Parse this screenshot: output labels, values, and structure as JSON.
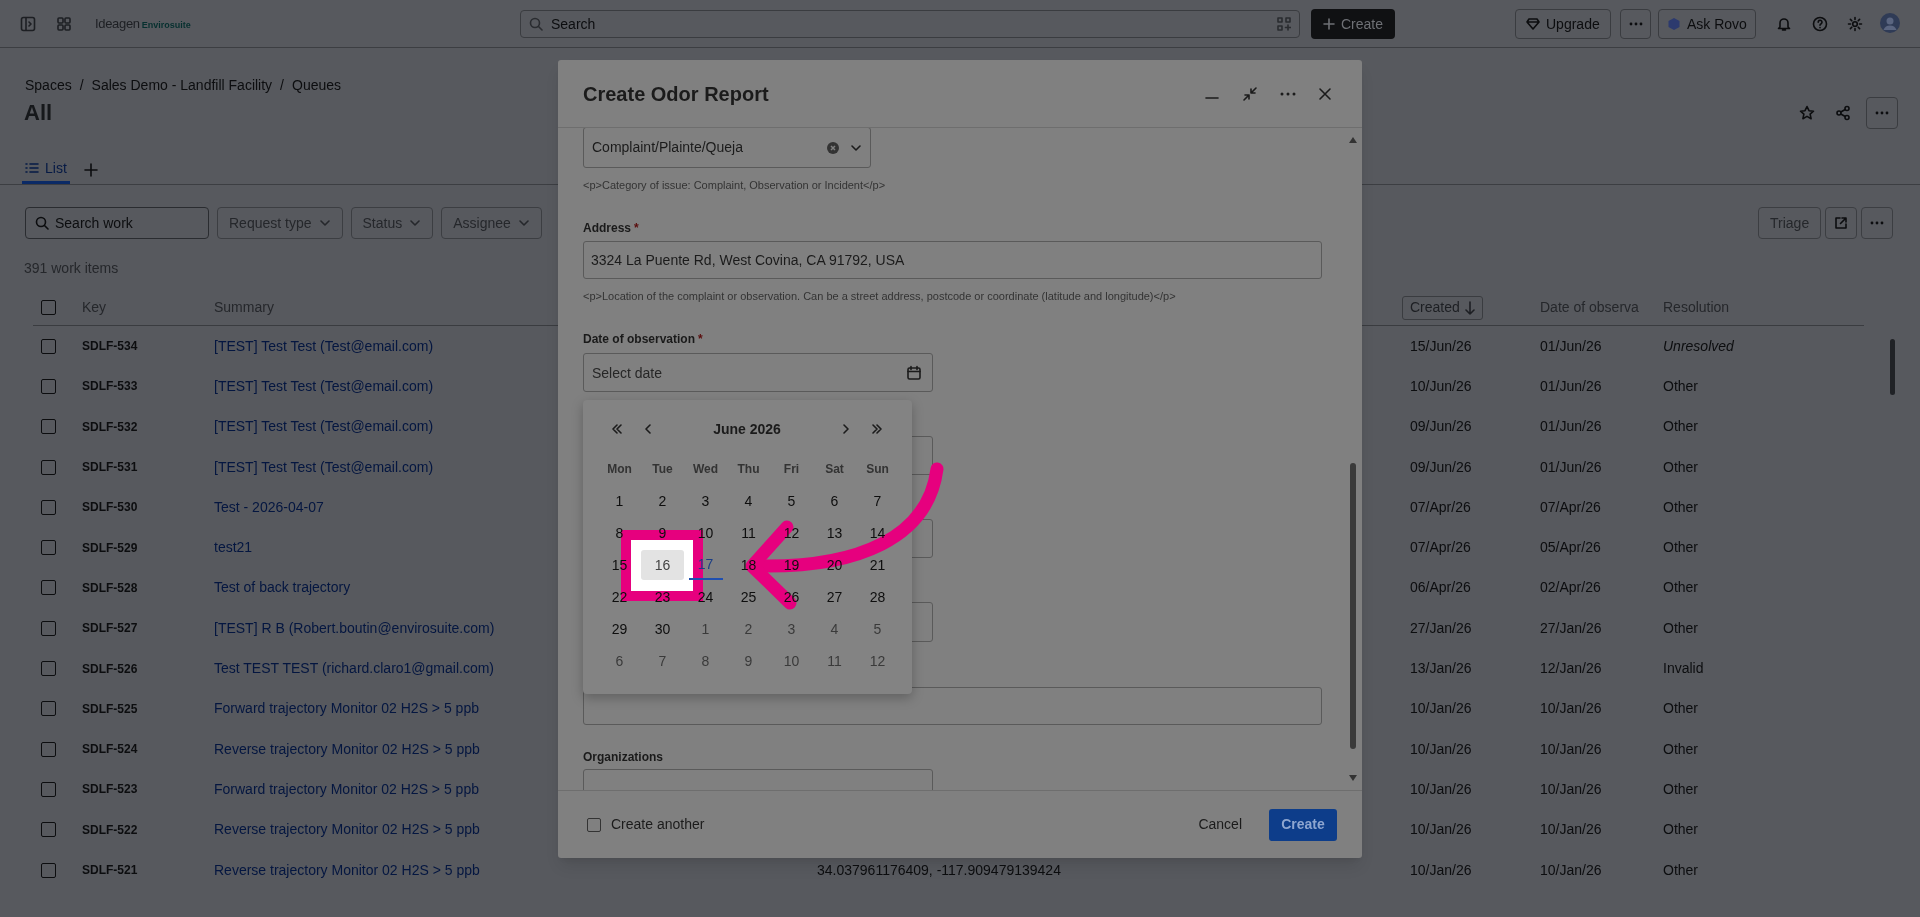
{
  "top_bar": {
    "logo": {
      "name": "Ideagen",
      "product": "Envirosuite"
    },
    "search": {
      "placeholder": "Search"
    },
    "create_button": "Create",
    "upgrade_button": "Upgrade",
    "ask_button": "Ask Rovo"
  },
  "breadcrumbs": {
    "separator": "/",
    "items": [
      "Spaces",
      "Sales Demo - Landfill Facility",
      "Queues"
    ]
  },
  "title": "All",
  "view_tabs": [
    {
      "label": "List",
      "selected": true
    }
  ],
  "filters": {
    "search": {
      "placeholder": "Search work"
    },
    "dropdowns": [
      "Request type",
      "Status",
      "Assignee"
    ],
    "triage_button": "Triage"
  },
  "count": "391 work items",
  "table": {
    "select_all_checked": false,
    "columns": [
      "Key",
      "Summary",
      "Created",
      "Date of observa",
      "Resolution"
    ],
    "rows": [
      {
        "key": "SDLF-534",
        "checked": false,
        "summary": "[TEST] Test Test (Test@email.com)",
        "created": "15/Jun/26",
        "date_of_observation": "01/Jun/26",
        "resolution": "Unresolved",
        "resolved": false
      },
      {
        "key": "SDLF-533",
        "checked": false,
        "summary": "[TEST] Test Test (Test@email.com)",
        "created": "10/Jun/26",
        "date_of_observation": "01/Jun/26",
        "resolution": "Other",
        "resolved": true
      },
      {
        "key": "SDLF-532",
        "checked": false,
        "summary": "[TEST] Test Test (Test@email.com)",
        "created": "09/Jun/26",
        "date_of_observation": "01/Jun/26",
        "resolution": "Other",
        "resolved": true
      },
      {
        "key": "SDLF-531",
        "checked": false,
        "summary": "[TEST] Test Test (Test@email.com)",
        "created": "09/Jun/26",
        "date_of_observation": "01/Jun/26",
        "resolution": "Other",
        "resolved": true
      },
      {
        "key": "SDLF-530",
        "checked": false,
        "summary": "Test - 2026-04-07",
        "created": "07/Apr/26",
        "date_of_observation": "07/Apr/26",
        "resolution": "Other",
        "resolved": true
      },
      {
        "key": "SDLF-529",
        "checked": false,
        "summary": "test21",
        "created": "07/Apr/26",
        "date_of_observation": "05/Apr/26",
        "resolution": "Other",
        "resolved": true
      },
      {
        "key": "SDLF-528",
        "checked": false,
        "summary": "Test of back trajectory",
        "created": "06/Apr/26",
        "date_of_observation": "02/Apr/26",
        "resolution": "Other",
        "resolved": true
      },
      {
        "key": "SDLF-527",
        "checked": false,
        "summary": "[TEST] R B (Robert.boutin@envirosuite.com)",
        "created": "27/Jan/26",
        "date_of_observation": "27/Jan/26",
        "resolution": "Other",
        "resolved": true
      },
      {
        "key": "SDLF-526",
        "checked": false,
        "summary": "Test TEST TEST (richard.claro1@gmail.com)",
        "created": "13/Jan/26",
        "date_of_observation": "12/Jan/26",
        "resolution": "Invalid",
        "resolved": true
      },
      {
        "key": "SDLF-525",
        "checked": false,
        "summary": "Forward trajectory Monitor 02 H2S > 5 ppb",
        "created": "10/Jan/26",
        "date_of_observation": "10/Jan/26",
        "resolution": "Other",
        "resolved": true
      },
      {
        "key": "SDLF-524",
        "checked": false,
        "summary": "Reverse trajectory Monitor 02 H2S > 5 ppb",
        "created": "10/Jan/26",
        "date_of_observation": "10/Jan/26",
        "resolution": "Other",
        "resolved": true
      },
      {
        "key": "SDLF-523",
        "checked": false,
        "summary": "Forward trajectory Monitor 02 H2S > 5 ppb",
        "created": "10/Jan/26",
        "date_of_observation": "10/Jan/26",
        "resolution": "Other",
        "resolved": true
      },
      {
        "key": "SDLF-522",
        "checked": false,
        "summary": "Reverse trajectory Monitor 02 H2S > 5 ppb",
        "created": "10/Jan/26",
        "date_of_observation": "10/Jan/26",
        "resolution": "Other",
        "resolved": true
      },
      {
        "key": "SDLF-521",
        "checked": false,
        "summary": "Reverse trajectory Monitor 02 H2S > 5 ppb",
        "column_3": "34.037961176409, -117.909479139424",
        "created": "10/Jan/26",
        "date_of_observation": "10/Jan/26",
        "resolution": "Other",
        "resolved": true
      }
    ]
  },
  "dialog": {
    "title": "Create Odor Report",
    "category": {
      "value": "Complaint/Plainte/Queja",
      "help": "<p>Category of issue: Complaint, Observation or Incident</p>"
    },
    "address": {
      "label": "Address",
      "required_mark": "*",
      "value": "3324 La Puente Rd, West Covina, CA 91792, USA",
      "help": "<p>Location of the complaint or observation. Can be a street address, postcode or coordinate (latitude and longitude)</p>"
    },
    "date": {
      "label": "Date of observation",
      "required_mark": "*",
      "placeholder": "Select date"
    },
    "organizations": {
      "label": "Organizations"
    },
    "calendar": {
      "month": "June 2026",
      "weekdays": [
        "Mon",
        "Tue",
        "Wed",
        "Thu",
        "Fri",
        "Sat",
        "Sun"
      ],
      "days": [
        {
          "label": "1",
          "outside": false,
          "today": false,
          "focused": false
        },
        {
          "label": "2",
          "outside": false,
          "today": false,
          "focused": false
        },
        {
          "label": "3",
          "outside": false,
          "today": false,
          "focused": false
        },
        {
          "label": "4",
          "outside": false,
          "today": false,
          "focused": false
        },
        {
          "label": "5",
          "outside": false,
          "today": false,
          "focused": false
        },
        {
          "label": "6",
          "outside": false,
          "today": false,
          "focused": false
        },
        {
          "label": "7",
          "outside": false,
          "today": false,
          "focused": false
        },
        {
          "label": "8",
          "outside": false,
          "today": false,
          "focused": false
        },
        {
          "label": "9",
          "outside": false,
          "today": false,
          "focused": false
        },
        {
          "label": "10",
          "outside": false,
          "today": false,
          "focused": false
        },
        {
          "label": "11",
          "outside": false,
          "today": false,
          "focused": false
        },
        {
          "label": "12",
          "outside": false,
          "today": false,
          "focused": false
        },
        {
          "label": "13",
          "outside": false,
          "today": false,
          "focused": false
        },
        {
          "label": "14",
          "outside": false,
          "today": false,
          "focused": false
        },
        {
          "label": "15",
          "outside": false,
          "today": false,
          "focused": false
        },
        {
          "label": "16",
          "outside": false,
          "today": false,
          "focused": true
        },
        {
          "label": "17",
          "outside": false,
          "today": true,
          "focused": false
        },
        {
          "label": "18",
          "outside": false,
          "today": false,
          "focused": false
        },
        {
          "label": "19",
          "outside": false,
          "today": false,
          "focused": false
        },
        {
          "label": "20",
          "outside": false,
          "today": false,
          "focused": false
        },
        {
          "label": "21",
          "outside": false,
          "today": false,
          "focused": false
        },
        {
          "label": "22",
          "outside": false,
          "today": false,
          "focused": false
        },
        {
          "label": "23",
          "outside": false,
          "today": false,
          "focused": false
        },
        {
          "label": "24",
          "outside": false,
          "today": false,
          "focused": false
        },
        {
          "label": "25",
          "outside": false,
          "today": false,
          "focused": false
        },
        {
          "label": "26",
          "outside": false,
          "today": false,
          "focused": false
        },
        {
          "label": "27",
          "outside": false,
          "today": false,
          "focused": false
        },
        {
          "label": "28",
          "outside": false,
          "today": false,
          "focused": false
        },
        {
          "label": "29",
          "outside": false,
          "today": false,
          "focused": false
        },
        {
          "label": "30",
          "outside": false,
          "today": false,
          "focused": false
        },
        {
          "label": "1",
          "outside": true,
          "today": false,
          "focused": false
        },
        {
          "label": "2",
          "outside": true,
          "today": false,
          "focused": false
        },
        {
          "label": "3",
          "outside": true,
          "today": false,
          "focused": false
        },
        {
          "label": "4",
          "outside": true,
          "today": false,
          "focused": false
        },
        {
          "label": "5",
          "outside": true,
          "today": false,
          "focused": false
        },
        {
          "label": "6",
          "outside": true,
          "today": false,
          "focused": false
        },
        {
          "label": "7",
          "outside": true,
          "today": false,
          "focused": false
        },
        {
          "label": "8",
          "outside": true,
          "today": false,
          "focused": false
        },
        {
          "label": "9",
          "outside": true,
          "today": false,
          "focused": false
        },
        {
          "label": "10",
          "outside": true,
          "today": false,
          "focused": false
        },
        {
          "label": "11",
          "outside": true,
          "today": false,
          "focused": false
        },
        {
          "label": "12",
          "outside": true,
          "today": false,
          "focused": false
        }
      ]
    },
    "create_another": {
      "label": "Create another",
      "checked": false
    },
    "cancel_button": "Cancel",
    "create_button": "Create"
  }
}
